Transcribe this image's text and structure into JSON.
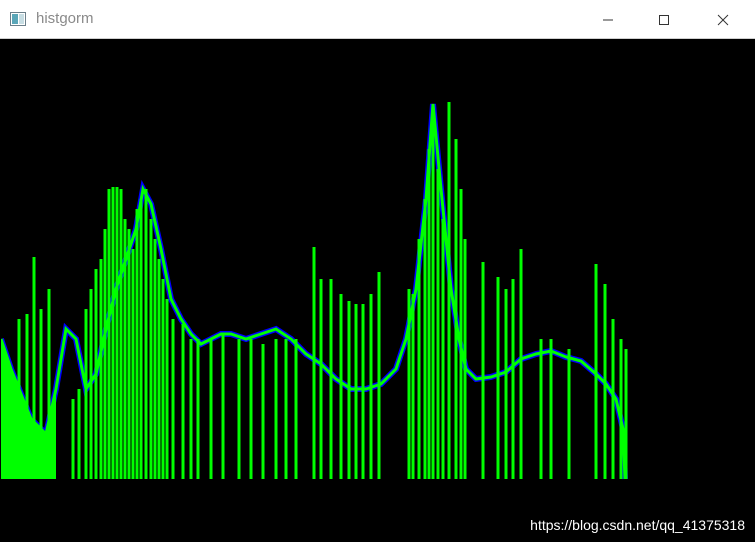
{
  "window": {
    "title": "histgorm",
    "icon": "app-window-icon",
    "controls": {
      "minimize": "minimize-icon",
      "maximize": "maximize-icon",
      "close": "close-icon"
    }
  },
  "plot": {
    "background_color": "#000000",
    "blue_curve_color": "#0000ff",
    "green_lines_color": "#00ff00"
  },
  "watermark": "https://blog.csdn.net/qq_41375318"
}
